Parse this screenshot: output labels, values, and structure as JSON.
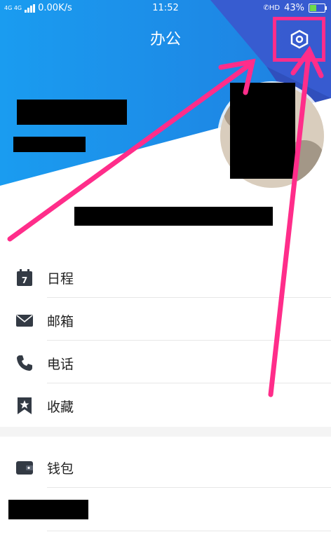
{
  "status_bar": {
    "network": "4G 4G",
    "speed": "0.00K/s",
    "time": "11:52",
    "hd": "HD",
    "battery": "43%"
  },
  "header": {
    "title": "办公",
    "settings_icon": "hexagon-settings-icon"
  },
  "menu": {
    "items": [
      {
        "label": "日程",
        "icon": "calendar-icon"
      },
      {
        "label": "邮箱",
        "icon": "mail-icon"
      },
      {
        "label": "电话",
        "icon": "phone-icon"
      },
      {
        "label": "收藏",
        "icon": "bookmark-star-icon"
      },
      {
        "label": "钱包",
        "icon": "wallet-icon"
      }
    ]
  },
  "colors": {
    "header_blue": "#1f8fe8",
    "header_blue_dark": "#3a4fc8",
    "annotation_pink": "#ff2d8a",
    "icon_gray": "#333a44"
  }
}
